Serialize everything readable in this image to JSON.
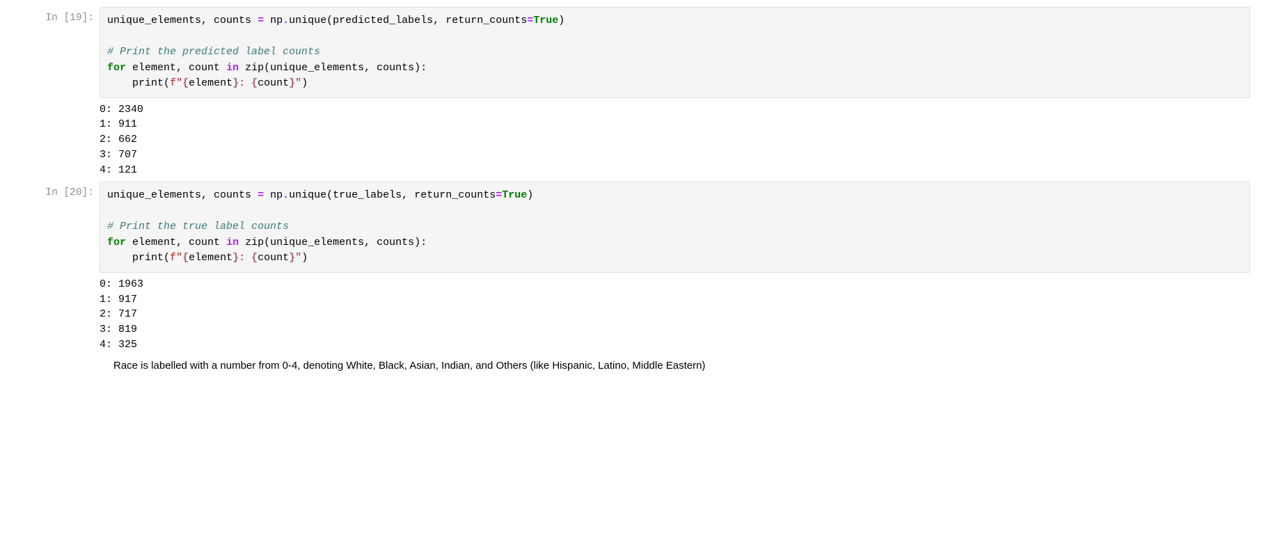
{
  "cells": [
    {
      "prompt": "In [19]:",
      "code": {
        "line1": {
          "a": "unique_elements",
          "comma1": ",",
          "b": " counts ",
          "eq": "=",
          "c": " np",
          "dot": ".",
          "d": "unique",
          "op": "(",
          "e": "predicted_labels",
          "comma2": ",",
          "f": " return_counts",
          "eq2": "=",
          "g": "True",
          "cp": ")"
        },
        "comment": "# Print the predicted label counts",
        "line3": {
          "kw_for": "for",
          "a": " element",
          "comma": ",",
          "b": " count ",
          "kw_in": "in",
          "c": " zip",
          "op": "(",
          "d": "unique_elements",
          "comma2": ",",
          "e": " counts",
          "cp": ")",
          "colon": ":"
        },
        "line4": {
          "indent": "    ",
          "a": "print",
          "op": "(",
          "f": "f",
          "q1": "\"",
          "br1": "{",
          "v1": "element",
          "br2": "}",
          "s1": ": ",
          "br3": "{",
          "v2": "count",
          "br4": "}",
          "q2": "\"",
          "cp": ")"
        }
      },
      "output": "0: 2340\n1: 911\n2: 662\n3: 707\n4: 121"
    },
    {
      "prompt": "In [20]:",
      "code": {
        "line1": {
          "a": "unique_elements",
          "comma1": ",",
          "b": " counts ",
          "eq": "=",
          "c": " np",
          "dot": ".",
          "d": "unique",
          "op": "(",
          "e": "true_labels",
          "comma2": ",",
          "f": " return_counts",
          "eq2": "=",
          "g": "True",
          "cp": ")"
        },
        "comment": "# Print the true label counts",
        "line3": {
          "kw_for": "for",
          "a": " element",
          "comma": ",",
          "b": " count ",
          "kw_in": "in",
          "c": " zip",
          "op": "(",
          "d": "unique_elements",
          "comma2": ",",
          "e": " counts",
          "cp": ")",
          "colon": ":"
        },
        "line4": {
          "indent": "    ",
          "a": "print",
          "op": "(",
          "f": "f",
          "q1": "\"",
          "br1": "{",
          "v1": "element",
          "br2": "}",
          "s1": ": ",
          "br3": "{",
          "v2": "count",
          "br4": "}",
          "q2": "\"",
          "cp": ")"
        }
      },
      "output": "0: 1963\n1: 917\n2: 717\n3: 819\n4: 325"
    }
  ],
  "markdown": "Race is labelled with a number from 0-4, denoting White, Black, Asian, Indian, and Others (like Hispanic, Latino, Middle Eastern)"
}
